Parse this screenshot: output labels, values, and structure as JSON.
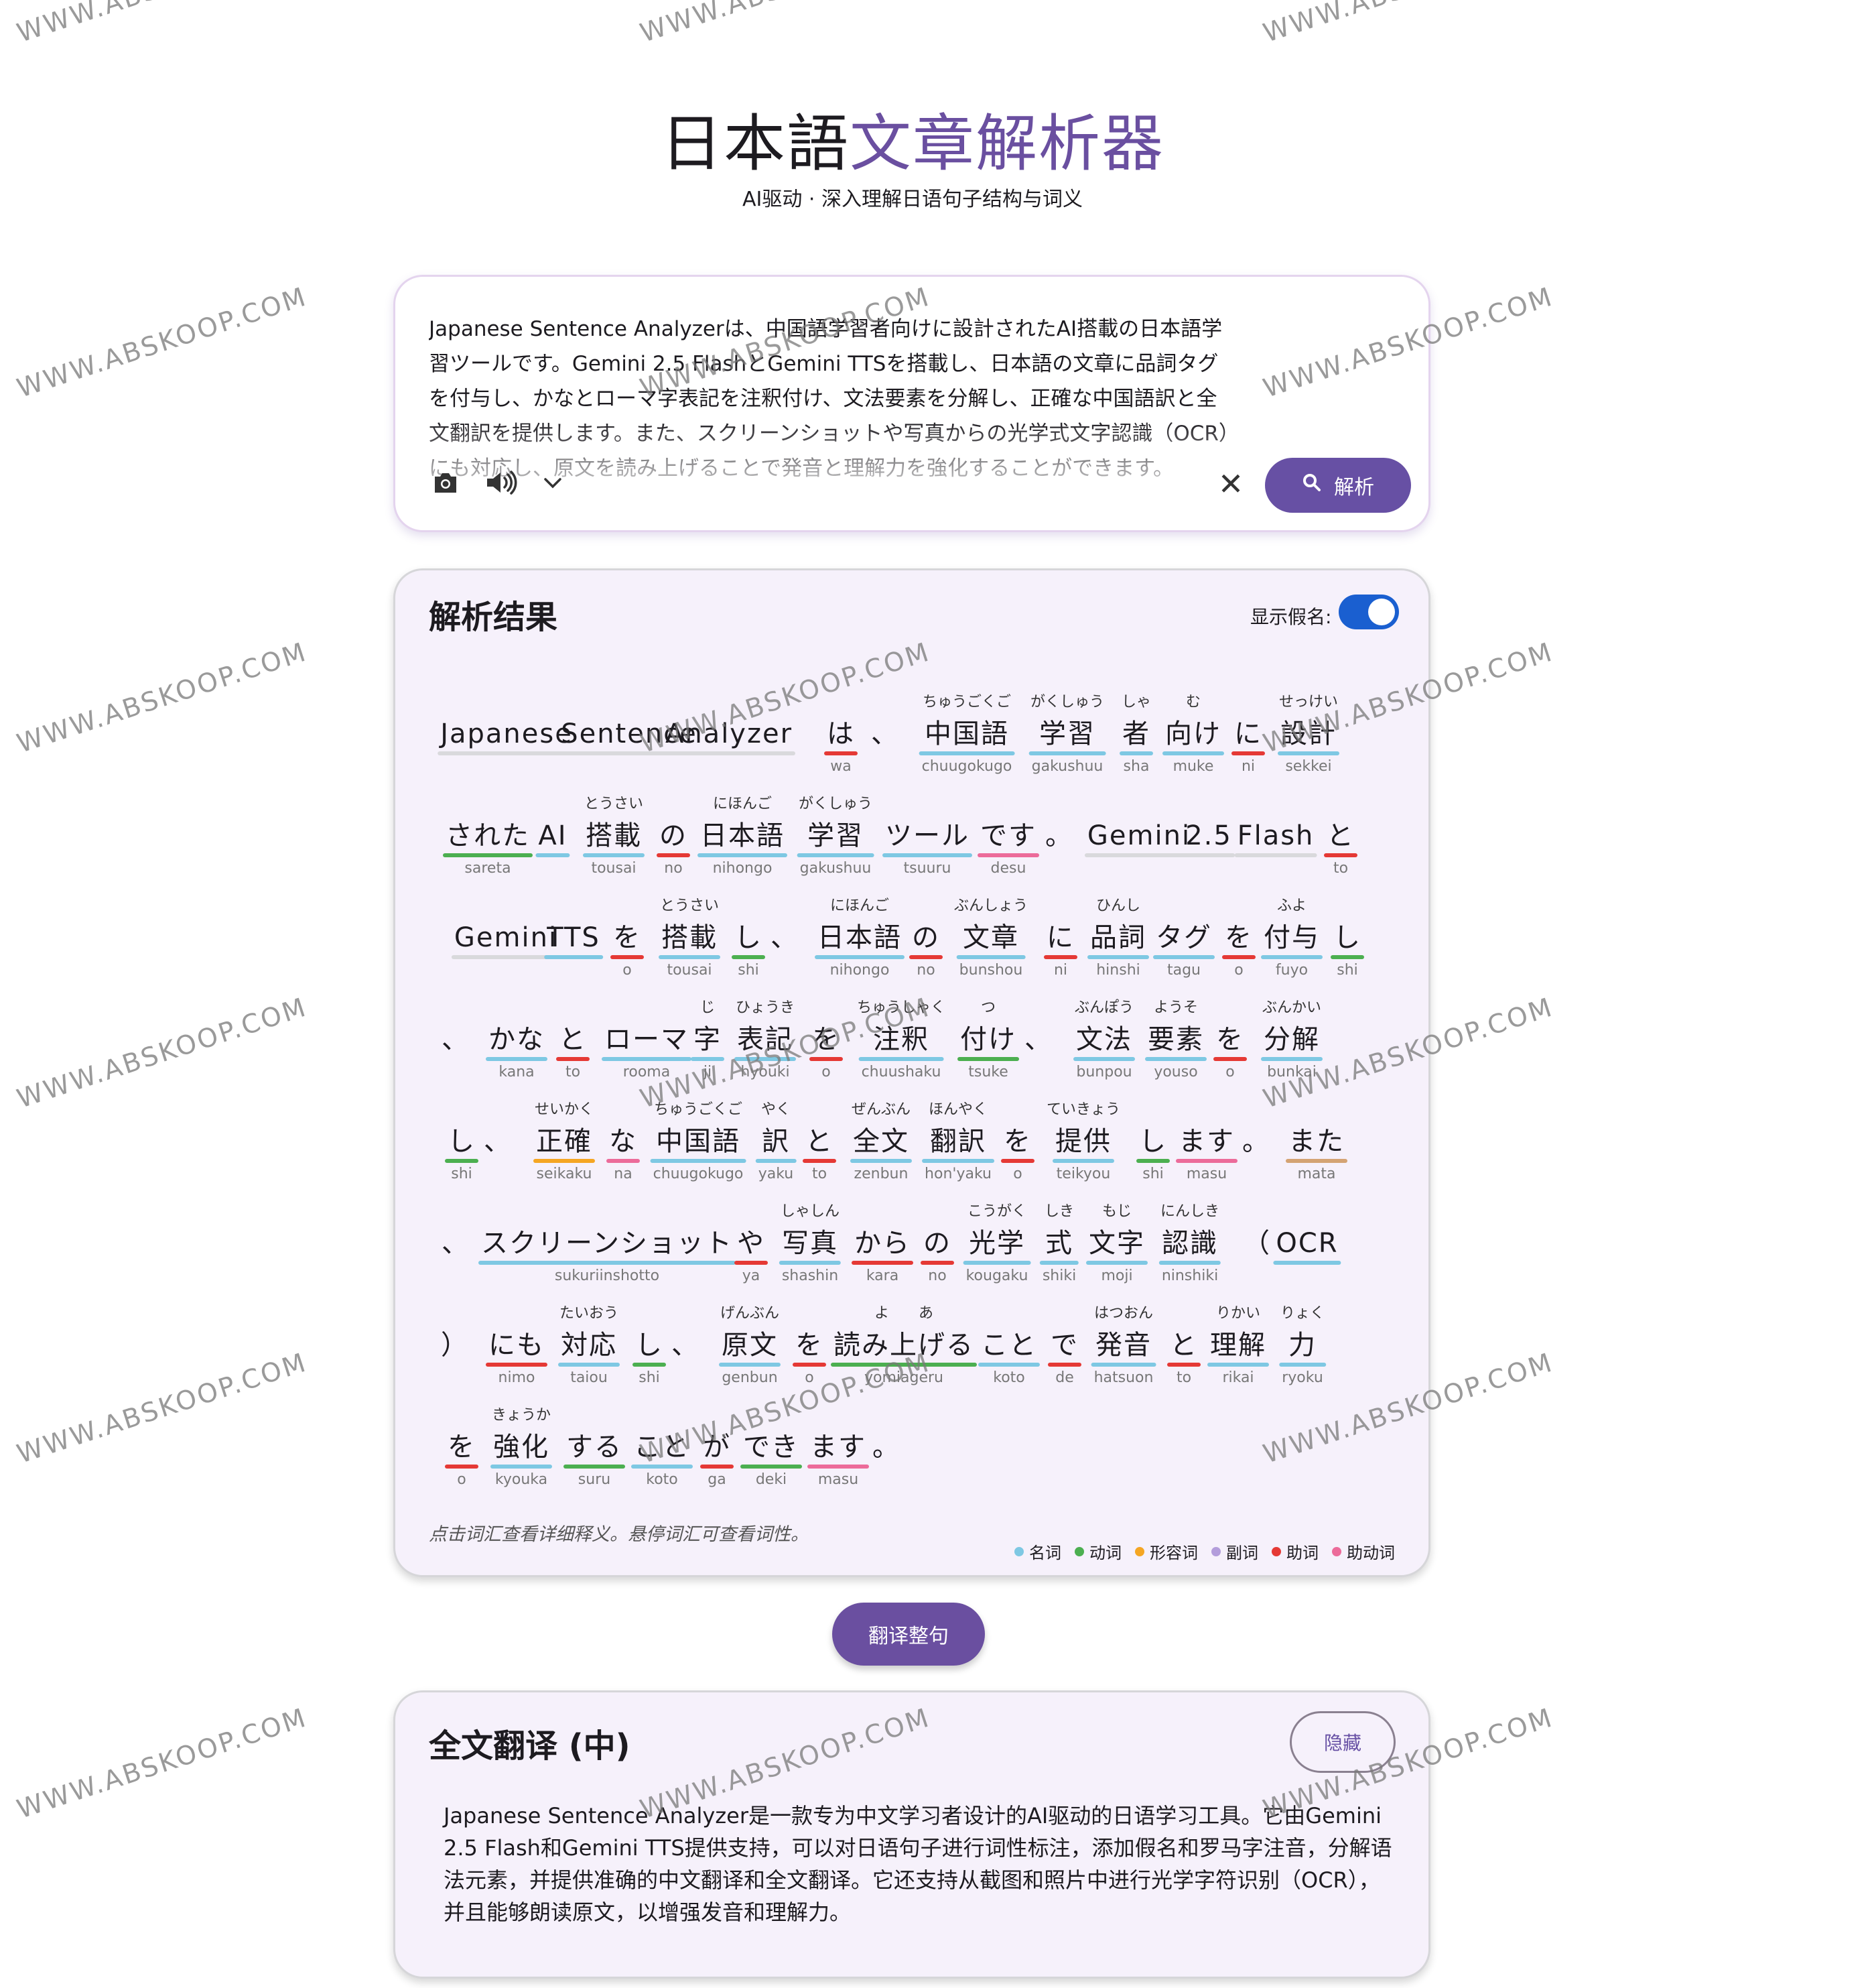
{
  "header": {
    "title_part1": "日本語",
    "title_part2": "文章解析器",
    "subtitle": "AI驱动 · 深入理解日语句子结构与词义"
  },
  "input": {
    "text": "Japanese Sentence Analyzerは、中国語学習者向けに設計されたAI搭載の日本語学習ツールです。Gemini 2.5 FlashとGemini TTSを搭載し、日本語の文章に品詞タグを付与し、かなとローマ字表記を注釈付け、文法要素を分解し、正確な中国語訳と全文翻訳を提供します。また、スクリーンショットや写真からの光学式文字認識（OCR）にも対応し、原文を読み上げることで発音と理解力を強化することができます。",
    "icons": [
      "camera-icon",
      "speaker-icon",
      "chevron-down-icon",
      "close-icon",
      "search-icon"
    ],
    "clear_label": "✕",
    "analyze_label": "解析"
  },
  "result": {
    "title": "解析结果",
    "kana_toggle_label": "显示假名:",
    "kana_toggle_on": true,
    "hint": "点击词汇查看详细释义。悬停词汇可查看词性。"
  },
  "legend": [
    {
      "label": "名词",
      "color": "#7ec8e3"
    },
    {
      "label": "动词",
      "color": "#4caf50"
    },
    {
      "label": "形容词",
      "color": "#f5a623"
    },
    {
      "label": "副词",
      "color": "#b39ddb"
    },
    {
      "label": "助词",
      "color": "#e53935"
    },
    {
      "label": "助动词",
      "color": "#ec6b9a"
    }
  ],
  "lines": [
    [
      {
        "w": "Japanese",
        "r": "",
        "f": "",
        "p": "other"
      },
      {
        "w": "Sentence",
        "r": "",
        "f": "",
        "p": "other"
      },
      {
        "w": "Analyzer",
        "r": "",
        "f": "",
        "p": "other"
      },
      {
        "w": "は",
        "r": "wa",
        "f": "",
        "p": "particle"
      },
      {
        "w": "、",
        "r": "",
        "f": "",
        "p": "punct"
      },
      {
        "w": "中国語",
        "r": "chuugokugo",
        "f": "ちゅうごくご",
        "p": "noun"
      },
      {
        "w": "学習",
        "r": "gakushuu",
        "f": "がくしゅう",
        "p": "noun"
      },
      {
        "w": "者",
        "r": "sha",
        "f": "しゃ",
        "p": "noun"
      },
      {
        "w": "向け",
        "r": "muke",
        "f": "む",
        "p": "noun"
      },
      {
        "w": "に",
        "r": "ni",
        "f": "",
        "p": "particle"
      },
      {
        "w": "設計",
        "r": "sekkei",
        "f": "せっけい",
        "p": "noun"
      }
    ],
    [
      {
        "w": "された",
        "r": "sareta",
        "f": "",
        "p": "verb"
      },
      {
        "w": "AI",
        "r": "",
        "f": "",
        "p": "noun"
      },
      {
        "w": "搭載",
        "r": "tousai",
        "f": "とうさい",
        "p": "noun"
      },
      {
        "w": "の",
        "r": "no",
        "f": "",
        "p": "particle"
      },
      {
        "w": "日本語",
        "r": "nihongo",
        "f": "にほんご",
        "p": "noun"
      },
      {
        "w": "学習",
        "r": "gakushuu",
        "f": "がくしゅう",
        "p": "noun"
      },
      {
        "w": "ツール",
        "r": "tsuuru",
        "f": "",
        "p": "noun"
      },
      {
        "w": "です",
        "r": "desu",
        "f": "",
        "p": "aux"
      },
      {
        "w": "。",
        "r": "",
        "f": "",
        "p": "punct"
      },
      {
        "w": "Gemini",
        "r": "",
        "f": "",
        "p": "other"
      },
      {
        "w": "2.5",
        "r": "",
        "f": "",
        "p": "other"
      },
      {
        "w": "Flash",
        "r": "",
        "f": "",
        "p": "other"
      },
      {
        "w": "と",
        "r": "to",
        "f": "",
        "p": "particle"
      }
    ],
    [
      {
        "w": "Gemini",
        "r": "",
        "f": "",
        "p": "other"
      },
      {
        "w": "TTS",
        "r": "",
        "f": "",
        "p": "noun"
      },
      {
        "w": "を",
        "r": "o",
        "f": "",
        "p": "particle"
      },
      {
        "w": "搭載",
        "r": "tousai",
        "f": "とうさい",
        "p": "noun"
      },
      {
        "w": "し",
        "r": "shi",
        "f": "",
        "p": "verb"
      },
      {
        "w": "、",
        "r": "",
        "f": "",
        "p": "punct"
      },
      {
        "w": "日本語",
        "r": "nihongo",
        "f": "にほんご",
        "p": "noun"
      },
      {
        "w": "の",
        "r": "no",
        "f": "",
        "p": "particle"
      },
      {
        "w": "文章",
        "r": "bunshou",
        "f": "ぶんしょう",
        "p": "noun"
      },
      {
        "w": "に",
        "r": "ni",
        "f": "",
        "p": "particle"
      },
      {
        "w": "品詞",
        "r": "hinshi",
        "f": "ひんし",
        "p": "noun"
      },
      {
        "w": "タグ",
        "r": "tagu",
        "f": "",
        "p": "noun"
      },
      {
        "w": "を",
        "r": "o",
        "f": "",
        "p": "particle"
      },
      {
        "w": "付与",
        "r": "fuyo",
        "f": "ふよ",
        "p": "noun"
      },
      {
        "w": "し",
        "r": "shi",
        "f": "",
        "p": "verb"
      }
    ],
    [
      {
        "w": "、",
        "r": "",
        "f": "",
        "p": "punct"
      },
      {
        "w": "かな",
        "r": "kana",
        "f": "",
        "p": "noun"
      },
      {
        "w": "と",
        "r": "to",
        "f": "",
        "p": "particle"
      },
      {
        "w": "ローマ",
        "r": "rooma",
        "f": "",
        "p": "noun"
      },
      {
        "w": "字",
        "r": "ji",
        "f": "じ",
        "p": "noun"
      },
      {
        "w": "表記",
        "r": "hyouki",
        "f": "ひょうき",
        "p": "noun"
      },
      {
        "w": "を",
        "r": "o",
        "f": "",
        "p": "particle"
      },
      {
        "w": "注釈",
        "r": "chuushaku",
        "f": "ちゅうしゃく",
        "p": "noun"
      },
      {
        "w": "付け",
        "r": "tsuke",
        "f": "つ",
        "p": "verb"
      },
      {
        "w": "、",
        "r": "",
        "f": "",
        "p": "punct"
      },
      {
        "w": "文法",
        "r": "bunpou",
        "f": "ぶんぽう",
        "p": "noun"
      },
      {
        "w": "要素",
        "r": "youso",
        "f": "ようそ",
        "p": "noun"
      },
      {
        "w": "を",
        "r": "o",
        "f": "",
        "p": "particle"
      },
      {
        "w": "分解",
        "r": "bunkai",
        "f": "ぶんかい",
        "p": "noun"
      }
    ],
    [
      {
        "w": "し",
        "r": "shi",
        "f": "",
        "p": "verb"
      },
      {
        "w": "、",
        "r": "",
        "f": "",
        "p": "punct"
      },
      {
        "w": "正確",
        "r": "seikaku",
        "f": "せいかく",
        "p": "adj"
      },
      {
        "w": "な",
        "r": "na",
        "f": "",
        "p": "aux"
      },
      {
        "w": "中国語",
        "r": "chuugokugo",
        "f": "ちゅうごくご",
        "p": "noun"
      },
      {
        "w": "訳",
        "r": "yaku",
        "f": "やく",
        "p": "noun"
      },
      {
        "w": "と",
        "r": "to",
        "f": "",
        "p": "particle"
      },
      {
        "w": "全文",
        "r": "zenbun",
        "f": "ぜんぶん",
        "p": "noun"
      },
      {
        "w": "翻訳",
        "r": "hon'yaku",
        "f": "ほんやく",
        "p": "noun"
      },
      {
        "w": "を",
        "r": "o",
        "f": "",
        "p": "particle"
      },
      {
        "w": "提供",
        "r": "teikyou",
        "f": "ていきょう",
        "p": "noun"
      },
      {
        "w": "し",
        "r": "shi",
        "f": "",
        "p": "verb"
      },
      {
        "w": "ます",
        "r": "masu",
        "f": "",
        "p": "aux"
      },
      {
        "w": "。",
        "r": "",
        "f": "",
        "p": "punct"
      },
      {
        "w": "また",
        "r": "mata",
        "f": "",
        "p": "conj"
      }
    ],
    [
      {
        "w": "、",
        "r": "",
        "f": "",
        "p": "punct"
      },
      {
        "w": "スクリーンショット",
        "r": "sukuriinshotto",
        "f": "",
        "p": "noun"
      },
      {
        "w": "や",
        "r": "ya",
        "f": "",
        "p": "particle"
      },
      {
        "w": "写真",
        "r": "shashin",
        "f": "しゃしん",
        "p": "noun"
      },
      {
        "w": "から",
        "r": "kara",
        "f": "",
        "p": "particle"
      },
      {
        "w": "の",
        "r": "no",
        "f": "",
        "p": "particle"
      },
      {
        "w": "光学",
        "r": "kougaku",
        "f": "こうがく",
        "p": "noun"
      },
      {
        "w": "式",
        "r": "shiki",
        "f": "しき",
        "p": "noun"
      },
      {
        "w": "文字",
        "r": "moji",
        "f": "もじ",
        "p": "noun"
      },
      {
        "w": "認識",
        "r": "ninshiki",
        "f": "にんしき",
        "p": "noun"
      },
      {
        "w": "（",
        "r": "",
        "f": "",
        "p": "punct"
      },
      {
        "w": "OCR",
        "r": "",
        "f": "",
        "p": "noun"
      }
    ],
    [
      {
        "w": "）",
        "r": "",
        "f": "",
        "p": "punct"
      },
      {
        "w": "にも",
        "r": "nimo",
        "f": "",
        "p": "particle"
      },
      {
        "w": "対応",
        "r": "taiou",
        "f": "たいおう",
        "p": "noun"
      },
      {
        "w": "し",
        "r": "shi",
        "f": "",
        "p": "verb"
      },
      {
        "w": "、",
        "r": "",
        "f": "",
        "p": "punct"
      },
      {
        "w": "原文",
        "r": "genbun",
        "f": "げんぶん",
        "p": "noun"
      },
      {
        "w": "を",
        "r": "o",
        "f": "",
        "p": "particle"
      },
      {
        "w": "読み上げる",
        "r": "yomiageru",
        "f": "よ　　あ",
        "p": "verb"
      },
      {
        "w": "こと",
        "r": "koto",
        "f": "",
        "p": "noun"
      },
      {
        "w": "で",
        "r": "de",
        "f": "",
        "p": "particle"
      },
      {
        "w": "発音",
        "r": "hatsuon",
        "f": "はつおん",
        "p": "noun"
      },
      {
        "w": "と",
        "r": "to",
        "f": "",
        "p": "particle"
      },
      {
        "w": "理解",
        "r": "rikai",
        "f": "りかい",
        "p": "noun"
      },
      {
        "w": "力",
        "r": "ryoku",
        "f": "りょく",
        "p": "noun"
      }
    ],
    [
      {
        "w": "を",
        "r": "o",
        "f": "",
        "p": "particle"
      },
      {
        "w": "強化",
        "r": "kyouka",
        "f": "きょうか",
        "p": "noun"
      },
      {
        "w": "する",
        "r": "suru",
        "f": "",
        "p": "verb"
      },
      {
        "w": "こと",
        "r": "koto",
        "f": "",
        "p": "noun"
      },
      {
        "w": "が",
        "r": "ga",
        "f": "",
        "p": "particle"
      },
      {
        "w": "でき",
        "r": "deki",
        "f": "",
        "p": "verb"
      },
      {
        "w": "ます",
        "r": "masu",
        "f": "",
        "p": "aux"
      },
      {
        "w": "。",
        "r": "",
        "f": "",
        "p": "punct"
      }
    ]
  ],
  "translate_button_label": "翻译整句",
  "translation": {
    "title": "全文翻译 (中)",
    "hide_label": "隐藏",
    "text": "Japanese Sentence Analyzer是一款专为中文学习者设计的AI驱动的日语学习工具。它由Gemini 2.5 Flash和Gemini TTS提供支持，可以对日语句子进行词性标注，添加假名和罗马字注音，分解语法元素，并提供准确的中文翻译和全文翻译。它还支持从截图和照片中进行光学字符识别（OCR），并且能够朗读原文，以增强发音和理解力。"
  },
  "watermark": "WWW.ABSKOOP.COM"
}
